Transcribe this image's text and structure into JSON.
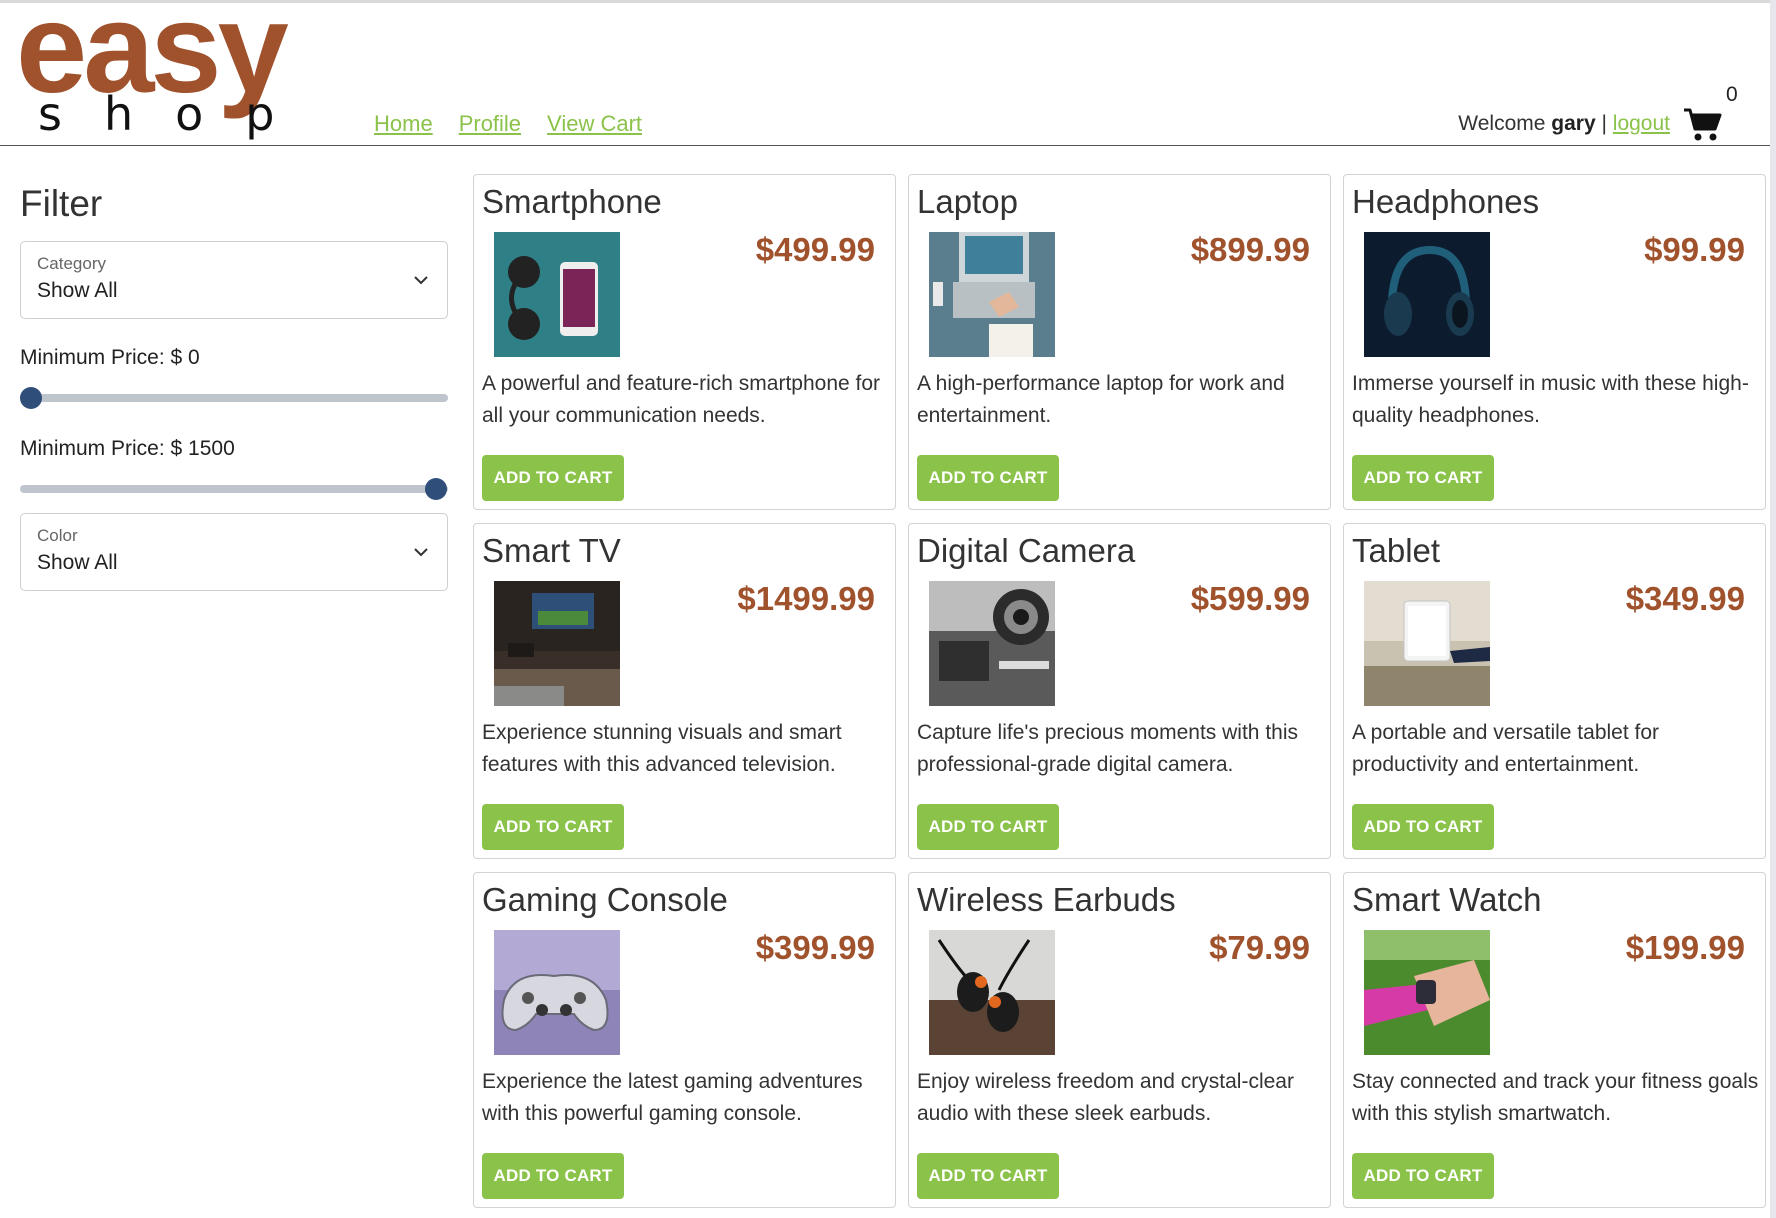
{
  "header": {
    "logo_top": "easy",
    "logo_bottom": "shop",
    "nav": [
      "Home",
      "Profile",
      "View Cart"
    ],
    "welcome_prefix": "Welcome",
    "username": "gary",
    "separator": "|",
    "logout": "logout",
    "cart_count": "0",
    "colors": {
      "brand": "#a0522d",
      "accent": "#8bc34a"
    }
  },
  "sidebar": {
    "title": "Filter",
    "category": {
      "label": "Category",
      "value": "Show All"
    },
    "min_price_label": "Minimum Price: $ 0",
    "min_price_slider": {
      "value": 0,
      "min": 0,
      "max": 1500
    },
    "max_price_label": "Minimum Price: $ 1500",
    "max_price_slider": {
      "value": 1500,
      "min": 0,
      "max": 1500
    },
    "color": {
      "label": "Color",
      "value": "Show All"
    }
  },
  "products": [
    {
      "name": "Smartphone",
      "price": "$499.99",
      "description": "A powerful and feature-rich smartphone for all your communication needs.",
      "button": "ADD TO CART"
    },
    {
      "name": "Laptop",
      "price": "$899.99",
      "description": "A high-performance laptop for work and entertainment.",
      "button": "ADD TO CART"
    },
    {
      "name": "Headphones",
      "price": "$99.99",
      "description": "Immerse yourself in music with these high-quality headphones.",
      "button": "ADD TO CART"
    },
    {
      "name": "Smart TV",
      "price": "$1499.99",
      "description": "Experience stunning visuals and smart features with this advanced television.",
      "button": "ADD TO CART"
    },
    {
      "name": "Digital Camera",
      "price": "$599.99",
      "description": "Capture life's precious moments with this professional-grade digital camera.",
      "button": "ADD TO CART"
    },
    {
      "name": "Tablet",
      "price": "$349.99",
      "description": "A portable and versatile tablet for productivity and entertainment.",
      "button": "ADD TO CART"
    },
    {
      "name": "Gaming Console",
      "price": "$399.99",
      "description": "Experience the latest gaming adventures with this powerful gaming console.",
      "button": "ADD TO CART"
    },
    {
      "name": "Wireless Earbuds",
      "price": "$79.99",
      "description": "Enjoy wireless freedom and crystal-clear audio with these sleek earbuds.",
      "button": "ADD TO CART"
    },
    {
      "name": "Smart Watch",
      "price": "$199.99",
      "description": "Stay connected and track your fitness goals with this stylish smartwatch.",
      "button": "ADD TO CART"
    }
  ]
}
